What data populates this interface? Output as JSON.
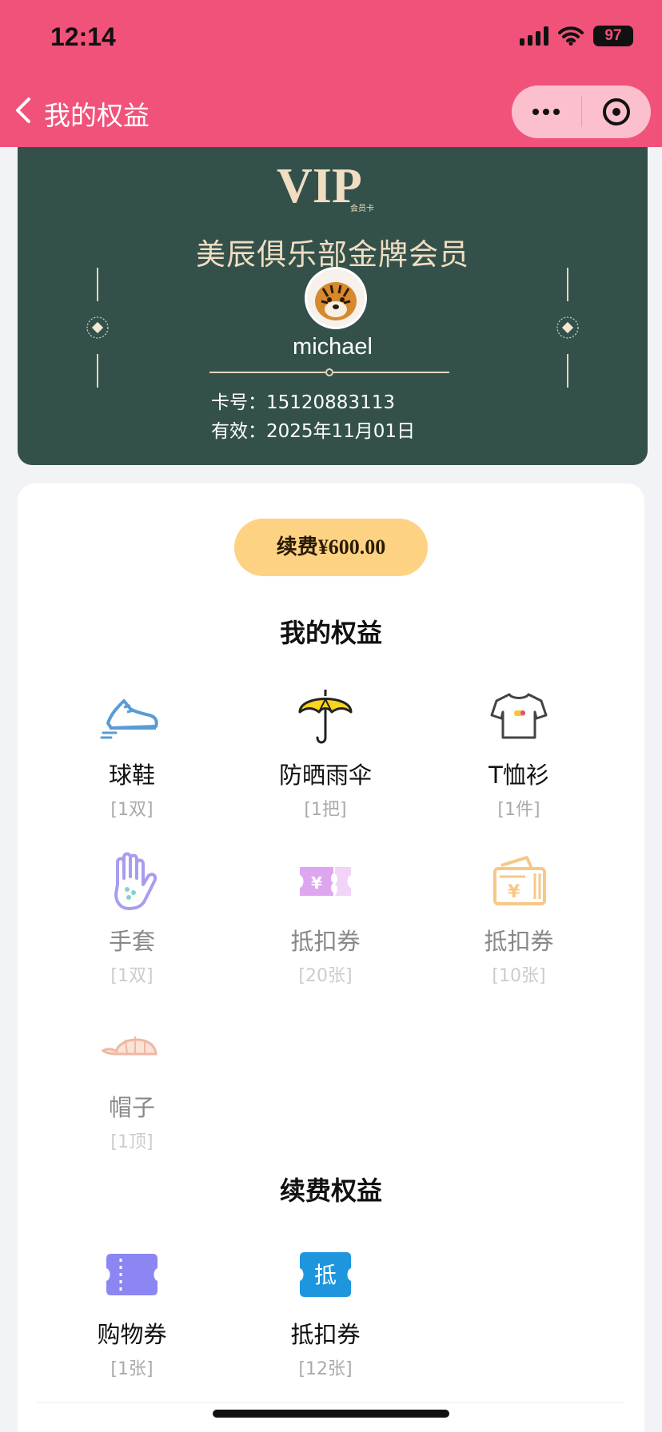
{
  "status_bar": {
    "time": "12:14",
    "battery": "97"
  },
  "nav": {
    "title": "我的权益"
  },
  "card": {
    "logo_text": "VIP",
    "logo_sub": "会员卡",
    "title": "美辰俱乐部金牌会员",
    "username": "michael",
    "card_no": "卡号：15120883113",
    "valid": "有效：2025年11月01日"
  },
  "renew_button": "续费¥600.00",
  "my_benefits": {
    "title": "我的权益",
    "items": [
      {
        "icon": "sneaker-icon",
        "name": "球鞋",
        "qty": "[1双]"
      },
      {
        "icon": "umbrella-icon",
        "name": "防晒雨伞",
        "qty": "[1把]"
      },
      {
        "icon": "tshirt-icon",
        "name": "T恤衫",
        "qty": "[1件]"
      },
      {
        "icon": "glove-icon",
        "name": "手套",
        "qty": "[1双]"
      },
      {
        "icon": "ticket-icon",
        "name": "抵扣券",
        "qty": "[20张]"
      },
      {
        "icon": "wallet-icon",
        "name": "抵扣券",
        "qty": "[10张]"
      },
      {
        "icon": "cap-icon",
        "name": "帽子",
        "qty": "[1顶]"
      }
    ]
  },
  "renew_benefits": {
    "title": "续费权益",
    "items": [
      {
        "icon": "shopping-coupon-icon",
        "name": "购物券",
        "qty": "[1张]"
      },
      {
        "icon": "deduct-coupon-icon",
        "name": "抵扣券",
        "qty": "[12张]",
        "badge": "抵"
      }
    ]
  },
  "colors": {
    "header": "#f1527a",
    "card": "#33514a",
    "renew_button": "#fdd283",
    "gold": "#f0ddc2"
  }
}
